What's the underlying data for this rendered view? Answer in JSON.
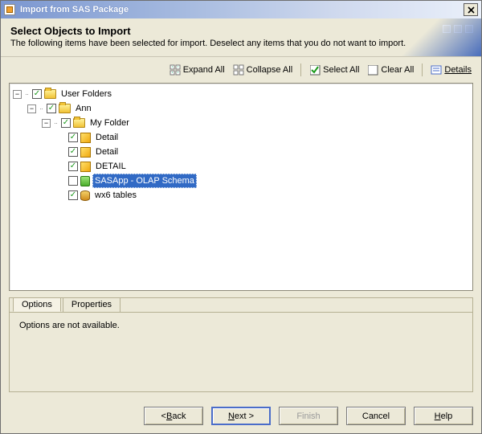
{
  "window": {
    "title": "Import from SAS Package"
  },
  "header": {
    "title": "Select Objects to Import",
    "subtitle": "The following items have been selected for import.  Deselect any items that you do not want to import."
  },
  "toolbar": {
    "expand_all": "Expand All",
    "collapse_all": "Collapse All",
    "select_all": "Select All",
    "clear_all": "Clear All",
    "details": "Details"
  },
  "tree": {
    "root": {
      "label": "User Folders",
      "checked": true,
      "children": [
        {
          "label": "Ann",
          "checked": true,
          "children": [
            {
              "label": "My Folder",
              "checked": true,
              "children": [
                {
                  "label": "Detail",
                  "checked": true,
                  "icon": "cube"
                },
                {
                  "label": "Detail",
                  "checked": true,
                  "icon": "cube"
                },
                {
                  "label": "DETAIL",
                  "checked": true,
                  "icon": "cube"
                },
                {
                  "label": "SASApp - OLAP Schema",
                  "checked": false,
                  "icon": "tree",
                  "selected": true
                },
                {
                  "label": "wx6 tables",
                  "checked": true,
                  "icon": "barrel"
                }
              ]
            }
          ]
        }
      ]
    }
  },
  "tabs": {
    "options": "Options",
    "properties": "Properties",
    "options_message": "Options are not available."
  },
  "buttons": {
    "back": "Back",
    "next": "Next >",
    "finish": "Finish",
    "cancel": "Cancel",
    "help": "Help"
  }
}
